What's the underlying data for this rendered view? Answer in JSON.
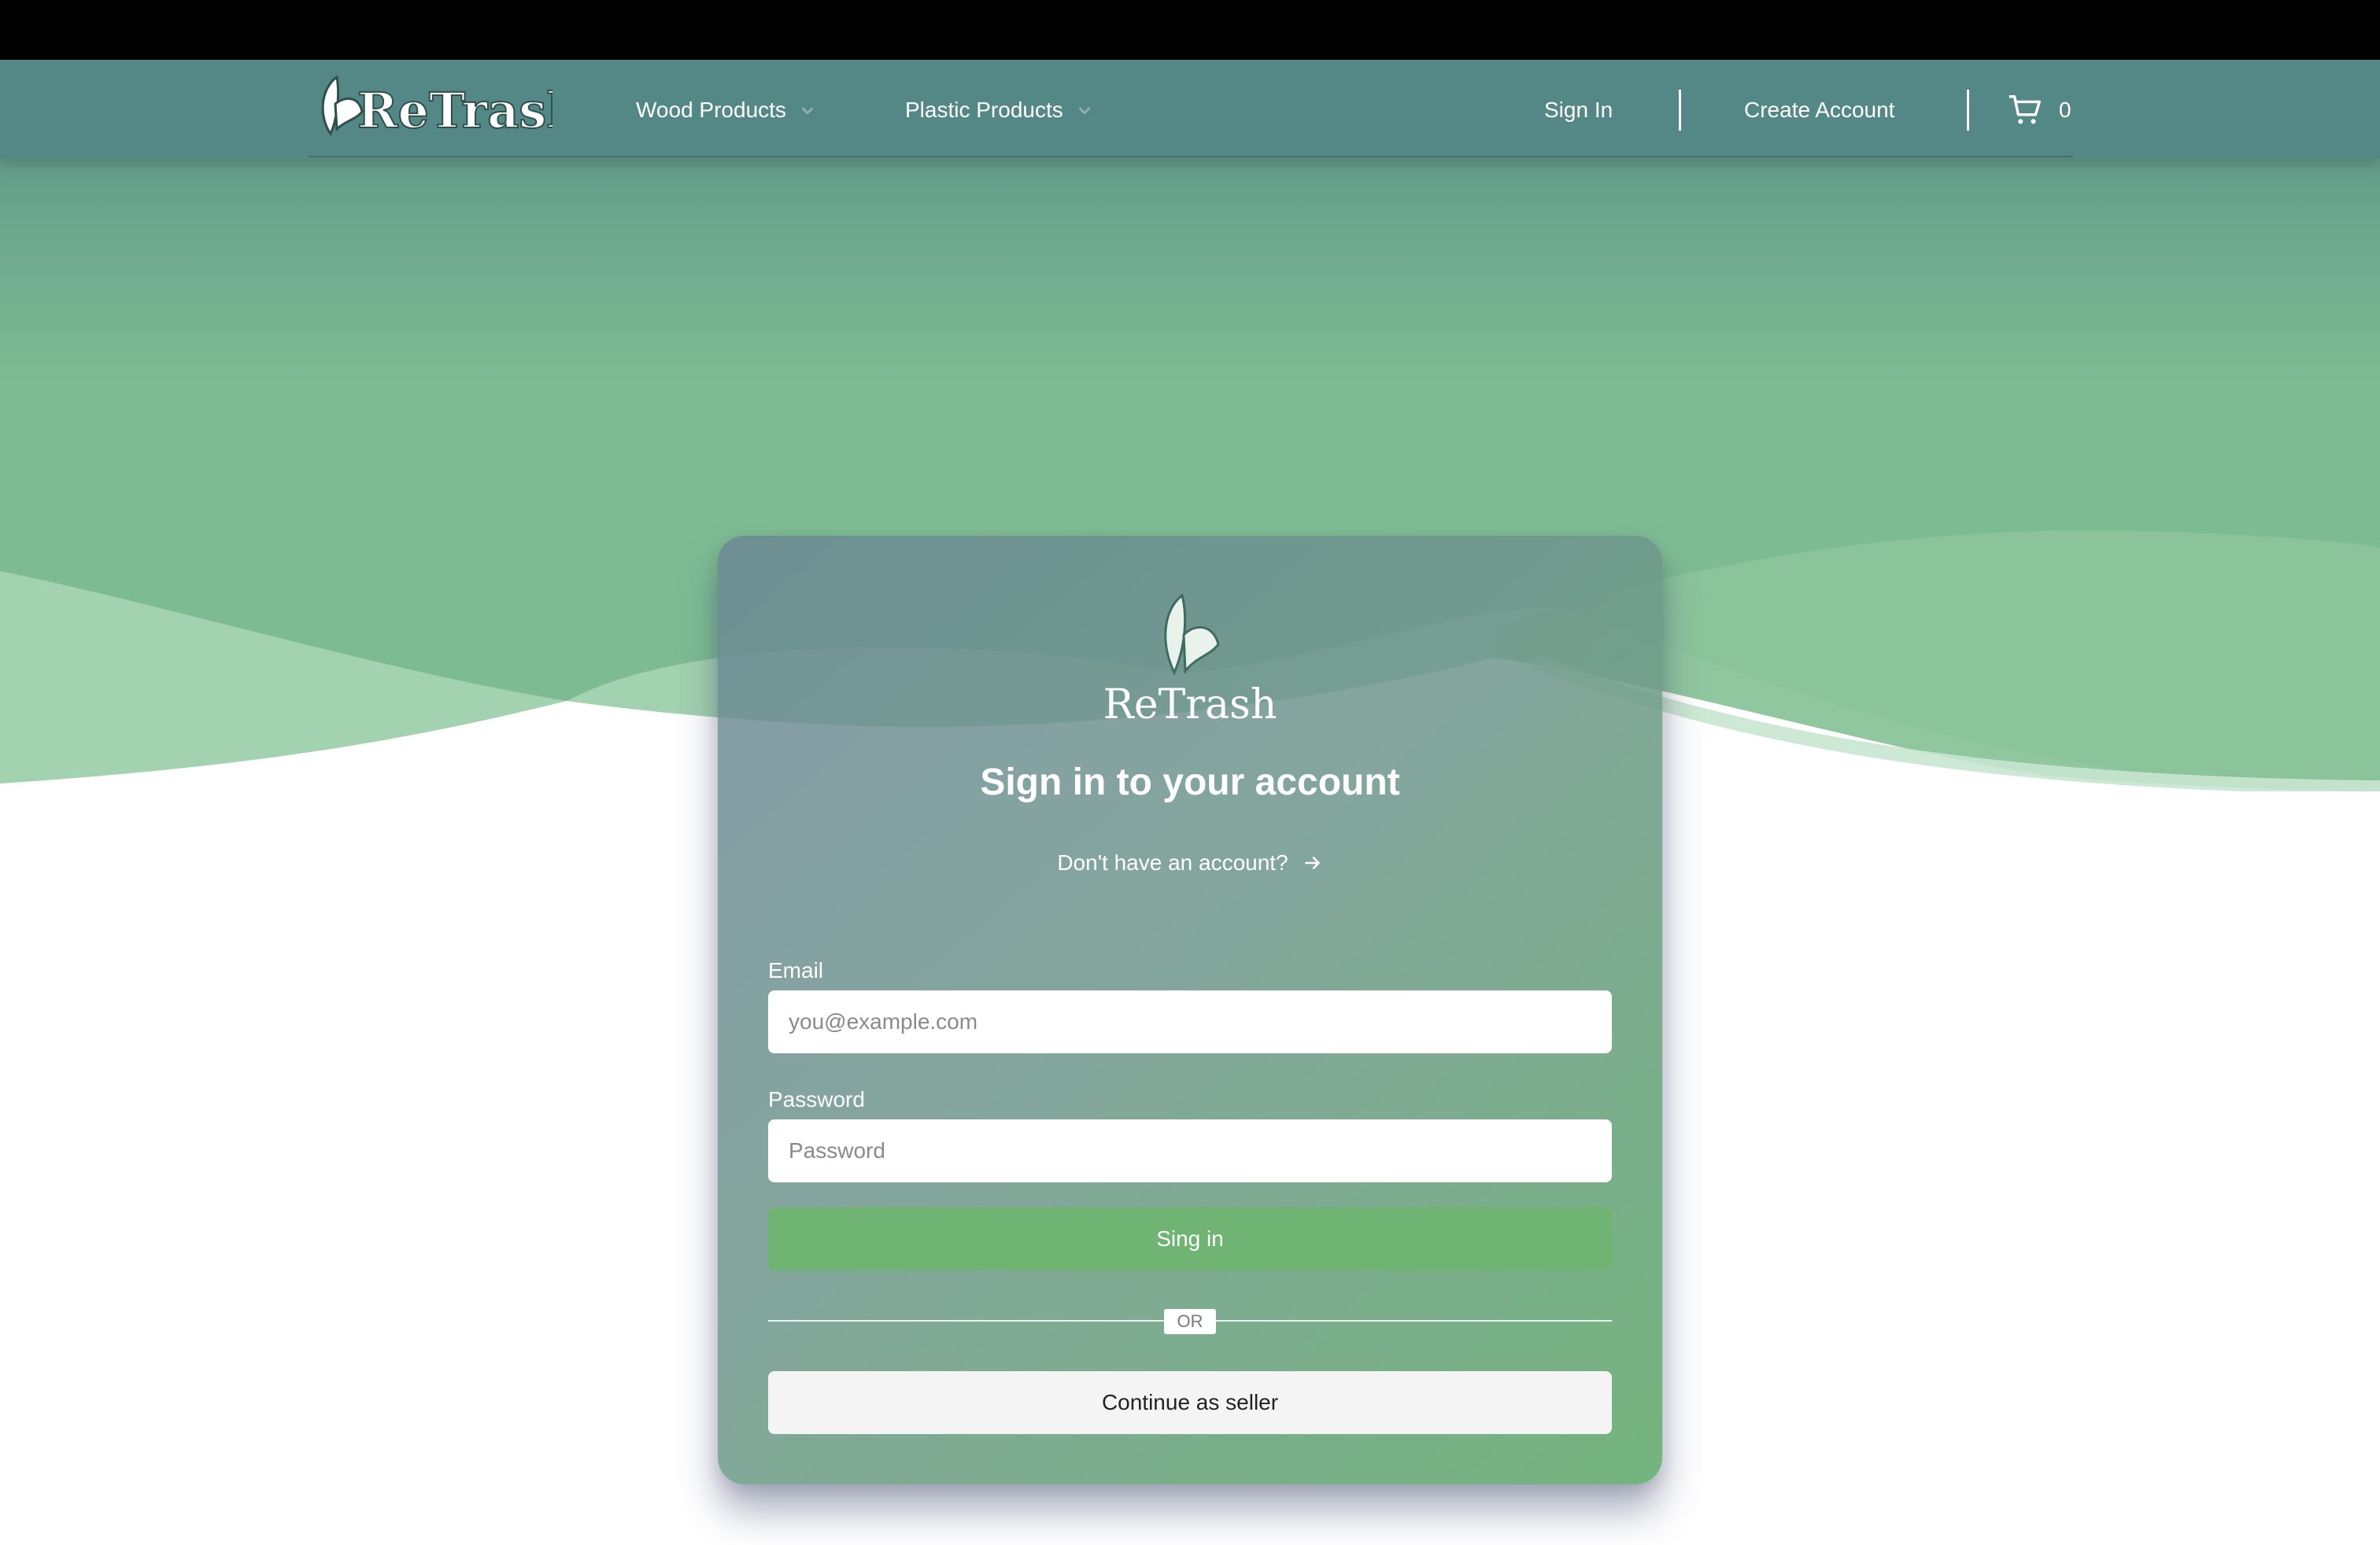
{
  "app": {
    "brand_name": "ReTrash"
  },
  "navbar": {
    "items": [
      {
        "label": "Wood Products",
        "has_dropdown": true
      },
      {
        "label": "Plastic Products",
        "has_dropdown": true
      }
    ],
    "sign_in_label": "Sign In",
    "create_account_label": "Create Account",
    "cart": {
      "icon": "cart-icon",
      "count": "0"
    }
  },
  "card": {
    "logo_text": "ReTrash",
    "title": "Sign in to your account",
    "signup_link": "Don't have an account?",
    "signup_link_icon": "arrow-right-icon",
    "email": {
      "label": "Email",
      "placeholder": "you@example.com",
      "value": ""
    },
    "password": {
      "label": "Password",
      "placeholder": "Password",
      "value": ""
    },
    "submit_label": "Sing in",
    "divider_text": "OR",
    "seller_label": "Continue as seller"
  },
  "colors": {
    "navbar": "#548886",
    "hero": "#7dbc93",
    "primary_button": "#6fb473",
    "secondary_button": "#f4f4f4"
  }
}
